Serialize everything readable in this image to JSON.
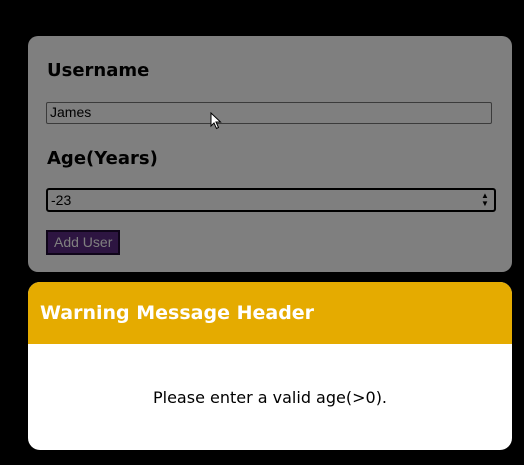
{
  "form": {
    "username_label": "Username",
    "username_value": "James",
    "age_label": "Age(Years)",
    "age_value": "-23",
    "add_button_label": "Add User"
  },
  "modal": {
    "title": "Warning Message Header",
    "message": "Please enter a valid age(>0).",
    "header_color": "#e5ab00"
  },
  "colors": {
    "background": "#000000",
    "button": "#5a2a82"
  }
}
